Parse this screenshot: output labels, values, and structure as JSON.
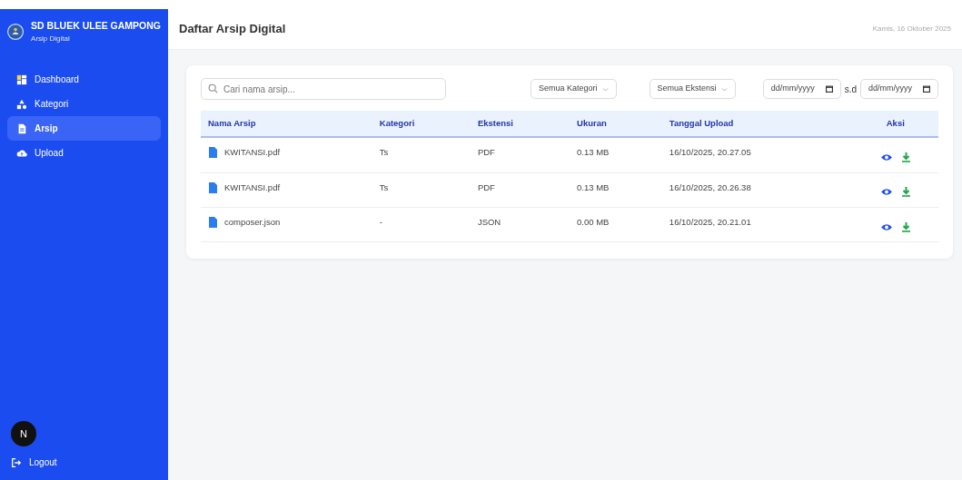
{
  "sidebar": {
    "school": "SD BLUEK ULEE GAMPONG",
    "subtitle": "Arsip Digital",
    "items": [
      {
        "label": "Dashboard",
        "selected": false
      },
      {
        "label": "Kategori",
        "selected": false
      },
      {
        "label": "Arsip",
        "selected": true
      },
      {
        "label": "Upload",
        "selected": false
      }
    ],
    "badge": "N",
    "logout": "Logout"
  },
  "header": {
    "title": "Daftar Arsip Digital",
    "date": "Kamis, 16 Oktober 2025"
  },
  "filters": {
    "search_placeholder": "Cari nama arsip...",
    "category": "Semua Kategori",
    "extension": "Semua Ekstensi",
    "date_from": "dd/mm/yyyy",
    "separator": "s.d",
    "date_to": "dd/mm/yyyy"
  },
  "table": {
    "columns": [
      "Nama Arsip",
      "Kategori",
      "Ekstensi",
      "Ukuran",
      "Tanggal Upload",
      "Aksi"
    ],
    "rows": [
      {
        "name": "KWITANSI.pdf",
        "category": "Ts",
        "extension": "PDF",
        "size": "0.13 MB",
        "uploaded": "16/10/2025, 20.27.05"
      },
      {
        "name": "KWITANSI.pdf",
        "category": "Ts",
        "extension": "PDF",
        "size": "0.13 MB",
        "uploaded": "16/10/2025, 20.26.38"
      },
      {
        "name": "composer.json",
        "category": "-",
        "extension": "JSON",
        "size": "0.00 MB",
        "uploaded": "16/10/2025, 20.21.01"
      }
    ]
  }
}
